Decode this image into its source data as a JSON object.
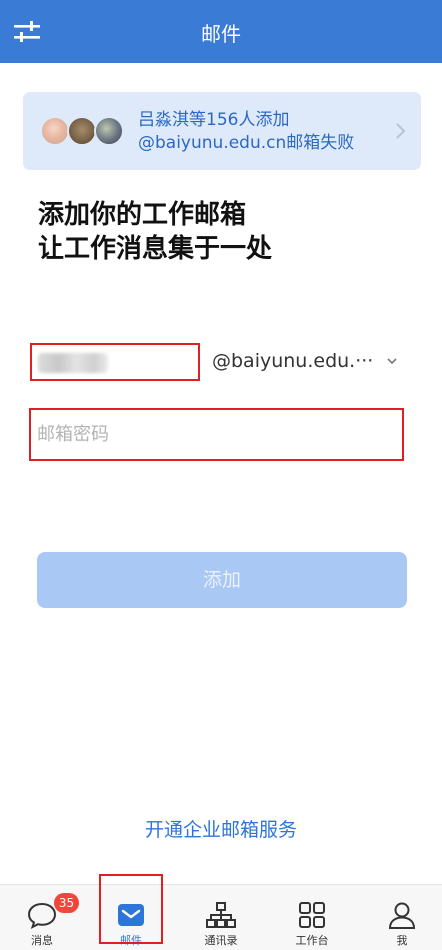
{
  "header": {
    "title": "邮件",
    "settings_icon": "sliders-icon",
    "color": "#3a7bd5"
  },
  "banner": {
    "line1": "吕淼淇等156人添加",
    "line2": "@baiyunu.edu.cn邮箱失败",
    "icon": "chevron-right-icon"
  },
  "headline": {
    "line1": "添加你的工作邮箱",
    "line2": "让工作消息集于一处"
  },
  "form": {
    "domain": "@baiyunu.edu.···",
    "password_placeholder": "邮箱密码",
    "add_label": "添加"
  },
  "service_link": "开通企业邮箱服务",
  "tabbar": {
    "tabs": [
      {
        "label": "消息",
        "icon": "chat-bubble-icon",
        "badge": "35"
      },
      {
        "label": "邮件",
        "icon": "mail-icon",
        "active": true
      },
      {
        "label": "通讯录",
        "icon": "org-chart-icon"
      },
      {
        "label": "工作台",
        "icon": "grid-icon"
      },
      {
        "label": "我",
        "icon": "person-icon"
      }
    ]
  },
  "colors": {
    "accent": "#2d75d9",
    "highlight_border": "#e02020",
    "button_disabled": "#a9c8f3",
    "badge": "#f0473d"
  }
}
